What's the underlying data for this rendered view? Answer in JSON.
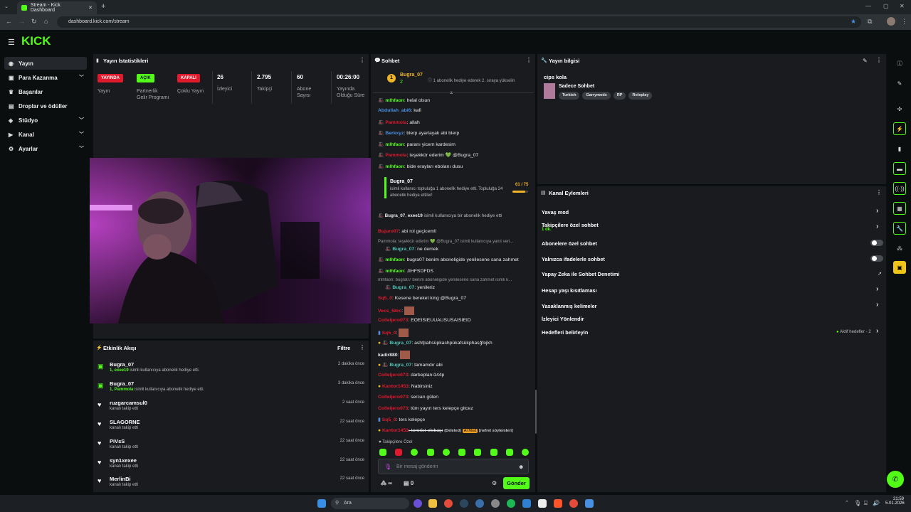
{
  "browser": {
    "tab_title": "Stream - Kick Dashboard",
    "url": "dashboard.kick.com/stream"
  },
  "header": {
    "logo": "KICK"
  },
  "sidebar": {
    "items": [
      {
        "label": "Yayın",
        "icon": "broadcast-icon",
        "active": true
      },
      {
        "label": "Para Kazanma",
        "icon": "money-icon",
        "chevron": true
      },
      {
        "label": "Başarılar",
        "icon": "trophy-icon"
      },
      {
        "label": "Droplar ve ödüller",
        "icon": "gift-icon"
      },
      {
        "label": "Stüdyo",
        "icon": "studio-icon",
        "chevron": true
      },
      {
        "label": "Kanal",
        "icon": "channel-icon",
        "chevron": true
      },
      {
        "label": "Ayarlar",
        "icon": "gear-icon",
        "chevron": true
      }
    ]
  },
  "stats": {
    "title": "Yayın İstatistikleri",
    "items": [
      {
        "badge": "YAYINDA",
        "label": "Yayın",
        "color": "#e1192d"
      },
      {
        "badge": "AÇIK",
        "label": "Partnerlik Gelir Programı",
        "color": "#53fc18"
      },
      {
        "badge": "KAPALI",
        "label": "Çoklu Yayın",
        "color": "#e1192d"
      },
      {
        "value": "26",
        "label": "İzleyici"
      },
      {
        "value": "2.795",
        "label": "Takipçi"
      },
      {
        "value": "60",
        "label": "Abone Sayısı"
      },
      {
        "value": "00:26:00",
        "label": "Yayında Olduğu Süre"
      }
    ]
  },
  "events": {
    "title": "Etkinlik Akışı",
    "filter_label": "Filtre",
    "items": [
      {
        "name": "Bugra_07",
        "highlight": "1, exee19",
        "sub": " isimli kullanıcıya abonelik hediye etti.",
        "time": "2 dakika önce",
        "type": "gift"
      },
      {
        "name": "Bugra_07",
        "highlight": "1, Pammola",
        "sub": " isimli kullanıcıya abonelik hediye etti.",
        "time": "3 dakika önce",
        "type": "gift"
      },
      {
        "name": "ruzgarcamsul0",
        "highlight": "",
        "sub": "kanalı takip etti",
        "time": "2 saat önce",
        "type": "follow"
      },
      {
        "name": "SLAGORNE",
        "highlight": "",
        "sub": "kanalı takip etti",
        "time": "22 saat önce",
        "type": "follow"
      },
      {
        "name": "PiVsS",
        "highlight": "",
        "sub": "kanalı takip etti",
        "time": "22 saat önce",
        "type": "follow"
      },
      {
        "name": "syn1xexee",
        "highlight": "",
        "sub": "kanalı takip etti",
        "time": "22 saat önce",
        "type": "follow"
      },
      {
        "name": "MerlinBi",
        "highlight": "",
        "sub": "kanalı takip etti",
        "time": "22 saat önce",
        "type": "follow"
      }
    ]
  },
  "chat": {
    "title": "Sohbet",
    "pinned": {
      "user": "Bugra_07",
      "count": "2",
      "text": "1 abonelik hediye ederek 2. sıraya yükselin"
    },
    "messages": [
      {
        "user": "mlhfaon",
        "color": "#53fc18",
        "text": ": helal olsun"
      },
      {
        "user": "Abdullah_abi6",
        "color": "#4a90e2",
        "text": ": kafi"
      },
      {
        "user": "Pammola",
        "color": "#e1192d",
        "text": ": allah"
      },
      {
        "user": "Berkxyz",
        "color": "#4a90e2",
        "text": ": blerp ayarlayak abi blerp"
      },
      {
        "user": "mlhfaon",
        "color": "#53fc18",
        "text": ": paranı yicem kardesim"
      },
      {
        "user": "Pammola",
        "color": "#e1192d",
        "text": ": teşekkür ederim 💚 @Bugra_07"
      },
      {
        "user": "mlhfaon",
        "color": "#53fc18",
        "text": ": bide erayları ebolarıı dusu"
      }
    ],
    "gift_card": {
      "user": "Bugra_07",
      "text": "isimli kullanıcı topluluğa 1 abonelik hediye etti. Topluluğa 24 abonelik hediye ettiler!",
      "progress": "61 / 75"
    },
    "gift_line": {
      "user": "Bugra_07",
      "target": "exee19",
      "text": " isimli kullanıcıya bir abonelik hediye etti"
    },
    "messages2": [
      {
        "user": "Bujuro07",
        "color": "#e1192d",
        "text": ": abi rol geçicemli"
      },
      {
        "user": "",
        "color": "#999",
        "text": "Pammola: teşekkür ederim 💚 @Bugra_07 isimli kullanıcıya yanıt veri..."
      },
      {
        "user": "Bugra_07",
        "color": "#4fc3b7",
        "text": ": ne demek"
      },
      {
        "user": "mlhfaon",
        "color": "#53fc18",
        "text": ": bugra07 benim aboneligide yenilesene sana zahmet"
      },
      {
        "user": "mlhfaon",
        "color": "#53fc18",
        "text": ": JIHFSDFDS"
      },
      {
        "user": "",
        "color": "#999",
        "text": "mlhfaon: bugra07 benim aboneligide yenilesene sana zahmet isimli k..."
      },
      {
        "user": "Bugra_07",
        "color": "#4fc3b7",
        "text": ": yenileriz"
      },
      {
        "user": "Sq5_0",
        "color": "#e1192d",
        "text": ": Kesene bereket king @Bugra_07"
      },
      {
        "user": "Vecs_58rc",
        "color": "#e1192d",
        "text": ":"
      },
      {
        "user": "Colleljero073",
        "color": "#e1192d",
        "text": ": EOEISIEUUAUSUSAISIEID"
      },
      {
        "user": "Sq5_0",
        "color": "#e1192d",
        "text": ":"
      },
      {
        "user": "Bugra_07",
        "color": "#4fc3b7",
        "text": ": ashfpahsüpkashpükafsükphasğfojkh"
      },
      {
        "user": "kadir880",
        "color": "#e8e8e8",
        "text": ":"
      },
      {
        "user": "Bugra_07",
        "color": "#4fc3b7",
        "text": ": tamamdır abi"
      },
      {
        "user": "Colleljero073",
        "color": "#e1192d",
        "text": ": darbeplanı144p"
      },
      {
        "user": "Kantor1453",
        "color": "#e1192d",
        "text": ": Nabirsiniz"
      },
      {
        "user": "Colleljero073",
        "color": "#e1192d",
        "text": ": sercan gülen"
      },
      {
        "user": "Colleljero073",
        "color": "#e1192d",
        "text": ": tüm yayın ters kelepçe gitcez"
      },
      {
        "user": "Sq5_0",
        "color": "#e1192d",
        "text": ": ters kelepçe"
      },
      {
        "user": "Kantor1453",
        "color": "#e1192d",
        "text": ": terorist elebaşı"
      }
    ],
    "deleted_label": "(Deleted)",
    "ai_mod_label": "AI Mod",
    "hate_label": "[nefret söylemleri]",
    "followers_only": "Takipçilere Özel",
    "input_placeholder": "Bir mesaj gönderin",
    "infinity": "∞",
    "count": "0",
    "send_label": "Gönder"
  },
  "stream_info": {
    "title": "Yayın bilgisi",
    "stream_title": "cips kola",
    "category": "Sadece Sohbet",
    "tags": [
      "Turkish",
      "Garrymods",
      "RP",
      "Roleplay"
    ]
  },
  "channel_actions": {
    "title": "Kanal Eylemleri",
    "items": [
      {
        "label": "Yavaş mod",
        "control": "chevron"
      },
      {
        "label": "Takipçilere özel sohbet",
        "sub": "1 dk.",
        "control": "chevron"
      },
      {
        "label": "Abonelere özel sohbet",
        "control": "toggle"
      },
      {
        "label": "Yalnızca ifadelerle sohbet",
        "control": "toggle"
      },
      {
        "label": "Yapay Zeka ile Sohbet Denetimi",
        "control": "external"
      },
      {
        "label": "Hesap yaşı kısıtlaması",
        "control": "chevron"
      },
      {
        "label": "Yasaklanmış kelimeler",
        "control": "chevron"
      },
      {
        "label": "İzleyici Yönlendir",
        "control": "none"
      },
      {
        "label": "Hedefleri belirleyin",
        "status": "Aktif hedefler - 2",
        "control": "chevron"
      }
    ]
  },
  "taskbar": {
    "search": "Ara",
    "time": "21:59",
    "date": "5.01.2026"
  },
  "colors": {
    "brand": "#53fc18",
    "live": "#e1192d",
    "panel": "#191b1f"
  }
}
